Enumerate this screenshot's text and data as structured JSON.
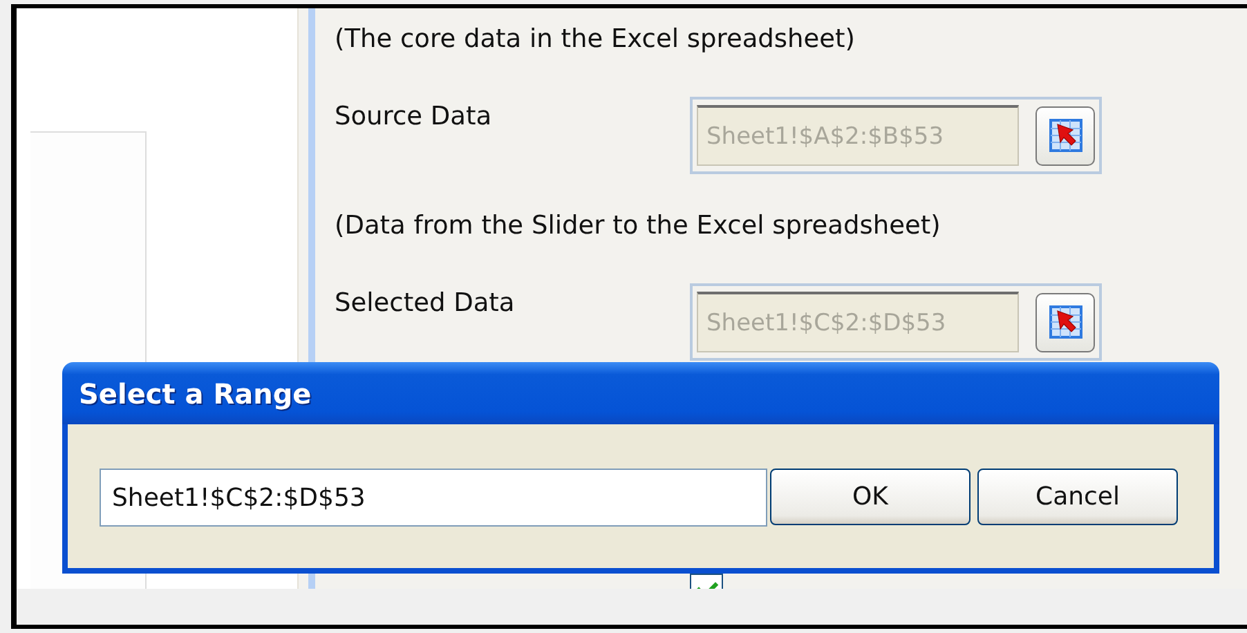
{
  "sections": [
    {
      "caption": "(The core data in the Excel spreadsheet)",
      "label": "Source Data",
      "value": "Sheet1!$A$2:$B$53",
      "disabled": true
    },
    {
      "caption": "(Data from the Slider to the Excel spreadsheet)",
      "label": "Selected Data",
      "value": "Sheet1!$C$2:$D$53",
      "disabled": true
    }
  ],
  "overview": {
    "checked": true
  },
  "dialog": {
    "title": "Select a Range",
    "value": "Sheet1!$C$2:$D$53",
    "buttons": [
      "OK",
      "Cancel"
    ]
  }
}
